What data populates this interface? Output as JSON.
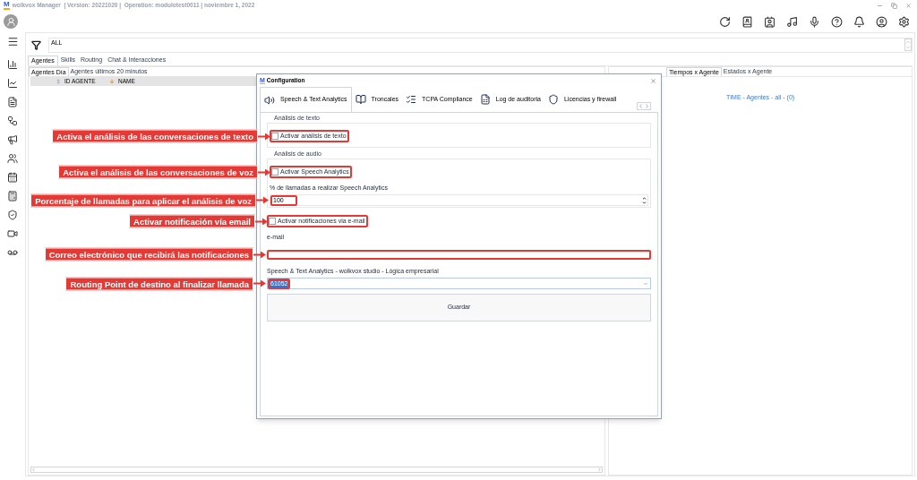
{
  "window": {
    "logo": "M",
    "title": "wolkvox Manager  | Version: 20221020 |  Operation: modulotest0011 | noviembre 1, 2022"
  },
  "filter": {
    "value": "ALL"
  },
  "main_tabs": [
    {
      "label": "Agentes",
      "selected": true
    },
    {
      "label": "Skills",
      "selected": false
    },
    {
      "label": "Routing",
      "selected": false
    },
    {
      "label": "Chat & Interacciones",
      "selected": false
    }
  ],
  "left_pane": {
    "tabs": [
      {
        "label": "Agentes Día",
        "selected": true
      },
      {
        "label": "Agentes últimos 20 minutos",
        "selected": false
      }
    ],
    "columns": [
      {
        "label": "ID AGENTE",
        "sorted": false
      },
      {
        "label": "NAME",
        "sorted": true
      }
    ]
  },
  "right_pane": {
    "tabs": [
      {
        "label": "Tiempos x Agente",
        "selected": true
      },
      {
        "label": "Estados x Agente",
        "selected": false
      }
    ],
    "chart_title": "TIME - Agentes - all - (0)"
  },
  "dialog": {
    "logo": "M",
    "title": "Configuration",
    "tabs": [
      {
        "label": "Speech & Text Analytics",
        "selected": true
      },
      {
        "label": "Troncales",
        "selected": false
      },
      {
        "label": "TCPA Compliance",
        "selected": false
      },
      {
        "label": "Log de auditoria",
        "selected": false
      },
      {
        "label": "Licencias y firewall",
        "selected": false
      }
    ],
    "fields": [
      {
        "kind": "group",
        "title": "Análisis de texto",
        "children": [
          {
            "kind": "checkbox",
            "label": "Activar análisis de texto",
            "checked": false,
            "callout": "Activa el análisis de las conversaciones de texto"
          }
        ]
      },
      {
        "kind": "group",
        "title": "Análisis de audio",
        "children": [
          {
            "kind": "checkbox",
            "label": "Activar Speech Analytics",
            "checked": false,
            "callout": "Activa el análisis de las conversaciones de voz"
          },
          {
            "kind": "caption",
            "label": "% de llamadas a realizar Speech Analytics"
          },
          {
            "kind": "spinner",
            "value": "100",
            "callout": "Porcentaje de llamadas para aplicar el análisis de voz"
          }
        ]
      },
      {
        "kind": "checkbox",
        "label": "Activar notificaciones via e-mail",
        "checked": false,
        "callout": "Activar notificación vía email"
      },
      {
        "kind": "caption",
        "label": "e-mail"
      },
      {
        "kind": "textbox",
        "callout": "Correo electrónico que recibirá las notificaciones"
      },
      {
        "kind": "caption",
        "label": "Speech & Text Analytics - wolkvox studio - Lógica empresarial"
      },
      {
        "kind": "dropdown",
        "value": "61052",
        "callout": "Routing Point de destino al finalizar llamada"
      },
      {
        "kind": "button",
        "label": "Guardar"
      }
    ]
  }
}
